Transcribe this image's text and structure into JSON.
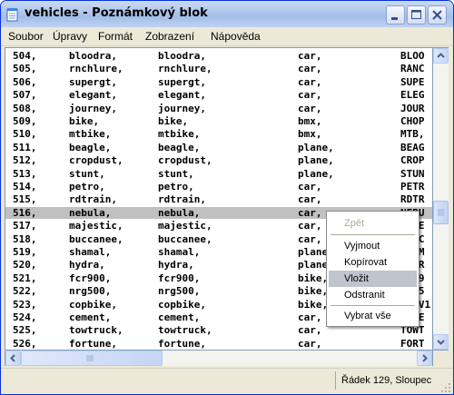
{
  "window": {
    "title": "vehicles - Poznámkový blok",
    "controls": [
      "minimize",
      "maximize",
      "close"
    ]
  },
  "menubar": [
    "Soubor",
    "Úpravy",
    "Formát",
    "Zobrazení",
    "Nápověda"
  ],
  "editor": {
    "rows": [
      [
        "504,",
        "bloodra,",
        "bloodra,",
        "car,",
        "BLOO"
      ],
      [
        "505,",
        "rnchlure,",
        "rnchlure,",
        "car,",
        "RANC"
      ],
      [
        "506,",
        "supergt,",
        "supergt,",
        "car,",
        "SUPE"
      ],
      [
        "507,",
        "elegant,",
        "elegant,",
        "car,",
        "ELEG"
      ],
      [
        "508,",
        "journey,",
        "journey,",
        "car,",
        "JOUR"
      ],
      [
        "509,",
        "bike,",
        "bike,",
        "bmx,",
        "CHOP"
      ],
      [
        "510,",
        "mtbike,",
        "mtbike,",
        "bmx,",
        "MTB,"
      ],
      [
        "511,",
        "beagle,",
        "beagle,",
        "plane,",
        "BEAG"
      ],
      [
        "512,",
        "cropdust,",
        "cropdust,",
        "plane,",
        "CROP"
      ],
      [
        "513,",
        "stunt,",
        "stunt,",
        "plane,",
        "STUN"
      ],
      [
        "514,",
        "petro,",
        "petro,",
        "car,",
        "PETR"
      ],
      [
        "515,",
        "rdtrain,",
        "rdtrain,",
        "car,",
        "RDTR"
      ],
      [
        "516,",
        "nebula,",
        "nebula,",
        "car,",
        "NEBU"
      ],
      [
        "517,",
        "majestic,",
        "majestic,",
        "car,",
        "MAJE"
      ],
      [
        "518,",
        "buccanee,",
        "buccanee,",
        "car,",
        "BUCC"
      ],
      [
        "519,",
        "shamal,",
        "shamal,",
        "plane,",
        "SHAM"
      ],
      [
        "520,",
        "hydra,",
        "hydra,",
        "plane,",
        "HYDR"
      ],
      [
        "521,",
        "fcr900,",
        "fcr900,",
        "bike,",
        "FCR9"
      ],
      [
        "522,",
        "nrg500,",
        "nrg500,",
        "bike,",
        "NRG5"
      ],
      [
        "523,",
        "copbike,",
        "copbike,",
        "bike,",
        "COPV1"
      ],
      [
        "524,",
        "cement,",
        "cement,",
        "car,",
        "CEME"
      ],
      [
        "525,",
        "towtruck,",
        "towtruck,",
        "car,",
        "TOWT"
      ],
      [
        "526,",
        "fortune,",
        "fortune,",
        "car,",
        "FORT"
      ]
    ],
    "selected_row_number": "516,"
  },
  "context_menu": {
    "items": [
      {
        "label": "Zpět",
        "enabled": false
      },
      {
        "label": "Vyjmout",
        "enabled": true
      },
      {
        "label": "Kopírovat",
        "enabled": true
      },
      {
        "label": "Vložit",
        "enabled": true,
        "highlighted": true
      },
      {
        "label": "Odstranit",
        "enabled": true
      },
      {
        "label": "Vybrat vše",
        "enabled": true
      }
    ]
  },
  "statusbar": {
    "position": "Řádek 129, Sloupec"
  },
  "colors": {
    "title_bar": "#b2c8ec",
    "selection": "#c0c0c0",
    "menu_highlight": "#c0c4cc",
    "border": "#7f9db9"
  }
}
